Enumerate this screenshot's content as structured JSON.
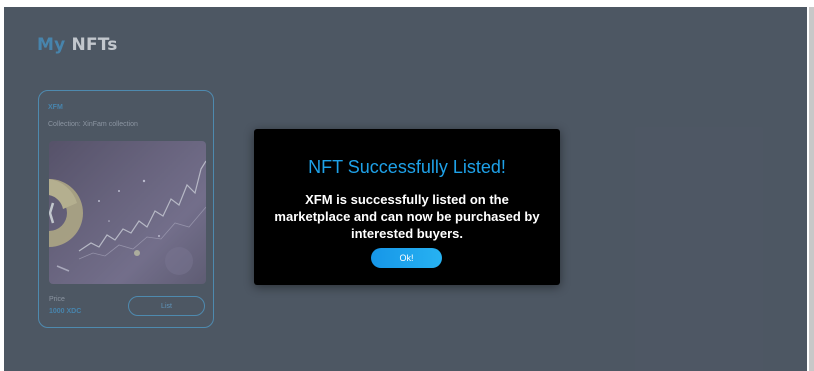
{
  "page": {
    "title_part1": "My",
    "title_part2": "NFTs"
  },
  "nft_card": {
    "name": "XFM",
    "collection": "Collection: XinFam collection",
    "price_label": "Price",
    "price_value": "1000 XDC",
    "list_label": "List"
  },
  "modal": {
    "title": "NFT Successfully Listed!",
    "message": "XFM is successfully listed on the marketplace and can now be purchased by interested buyers.",
    "ok_label": "Ok!"
  },
  "colors": {
    "accent": "#1f86c4",
    "modal_title": "#1ea1e8",
    "ok_button": "#1a9ff0",
    "app_background": "#2b333f"
  }
}
